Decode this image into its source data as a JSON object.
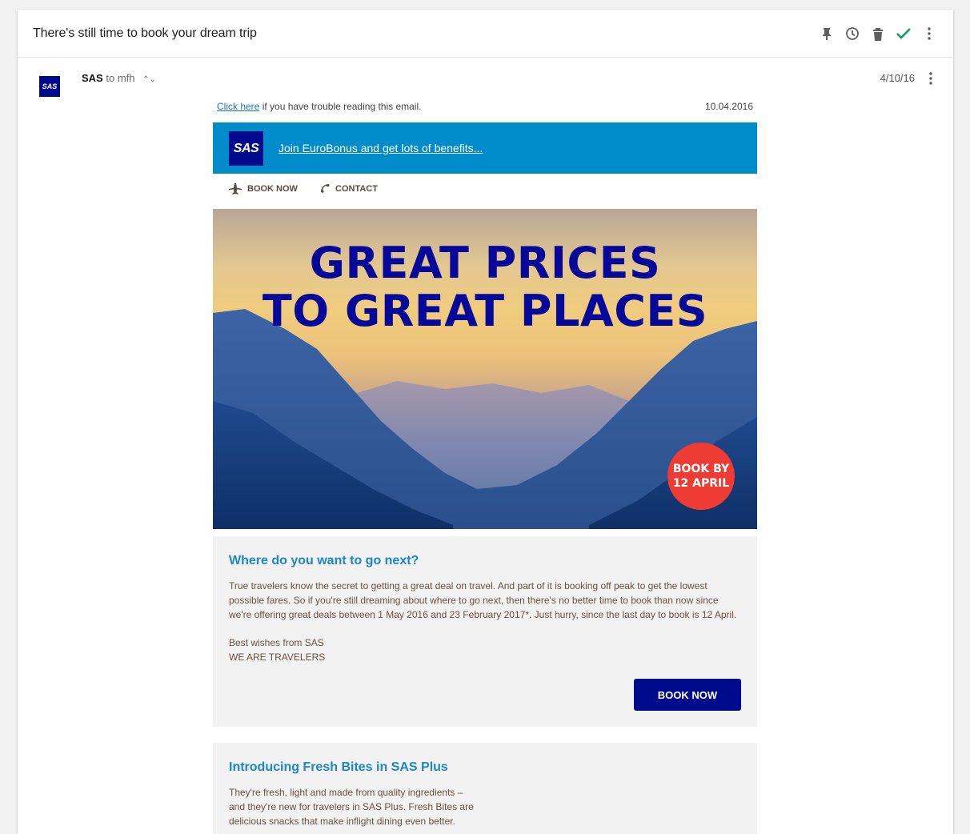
{
  "thread": {
    "subject": "There's still time to book your dream trip"
  },
  "toolbar": {
    "icons": [
      "pin-icon",
      "clock-icon",
      "trash-icon",
      "check-icon",
      "more-vert-icon"
    ],
    "check_color": "#0f9d58"
  },
  "message": {
    "sender": "SAS",
    "recipient": "to mfh",
    "date": "4/10/16",
    "avatar_text": "SAS"
  },
  "email": {
    "click_here": "Click here",
    "trouble_text": " if you have trouble reading this email.",
    "email_date": "10.04.2016",
    "logo_text": "SAS",
    "join_link": "Join EuroBonus and get lots of benefits...",
    "nav": {
      "book_now": "BOOK NOW",
      "contact": "CONTACT"
    },
    "hero": {
      "line1": "GREAT PRICES",
      "line2": "TO GREAT PLACES",
      "badge_line1": "BOOK BY",
      "badge_line2": "12 APRIL"
    },
    "section1": {
      "title": "Where do you want to go next?",
      "body": "True travelers know the secret to getting a great deal on travel. And part of it is booking off peak to get the lowest possible fares. So if you're still dreaming about where to go next, then there's no better time to book than now since we're offering great deals between 1 May 2016 and 23 February 2017*. Just hurry, since the last day to book is 12 April.",
      "signoff1": "Best wishes from SAS",
      "signoff2": "WE ARE TRAVELERS",
      "button": "BOOK NOW"
    },
    "section2": {
      "title": "Introducing Fresh Bites in SAS Plus",
      "body_line1": "They're fresh, light and made from quality ingredients –",
      "body_line2": "and they're new for travelers in SAS Plus. Fresh Bites are",
      "body_line3": "delicious snacks that make inflight dining even better."
    }
  },
  "colors": {
    "sas_blue": "#000a8c",
    "header_blue": "#008ccb",
    "title_blue": "#1a87c9",
    "badge_red": "#ee3b34",
    "body_brown": "#6b4f3b"
  }
}
